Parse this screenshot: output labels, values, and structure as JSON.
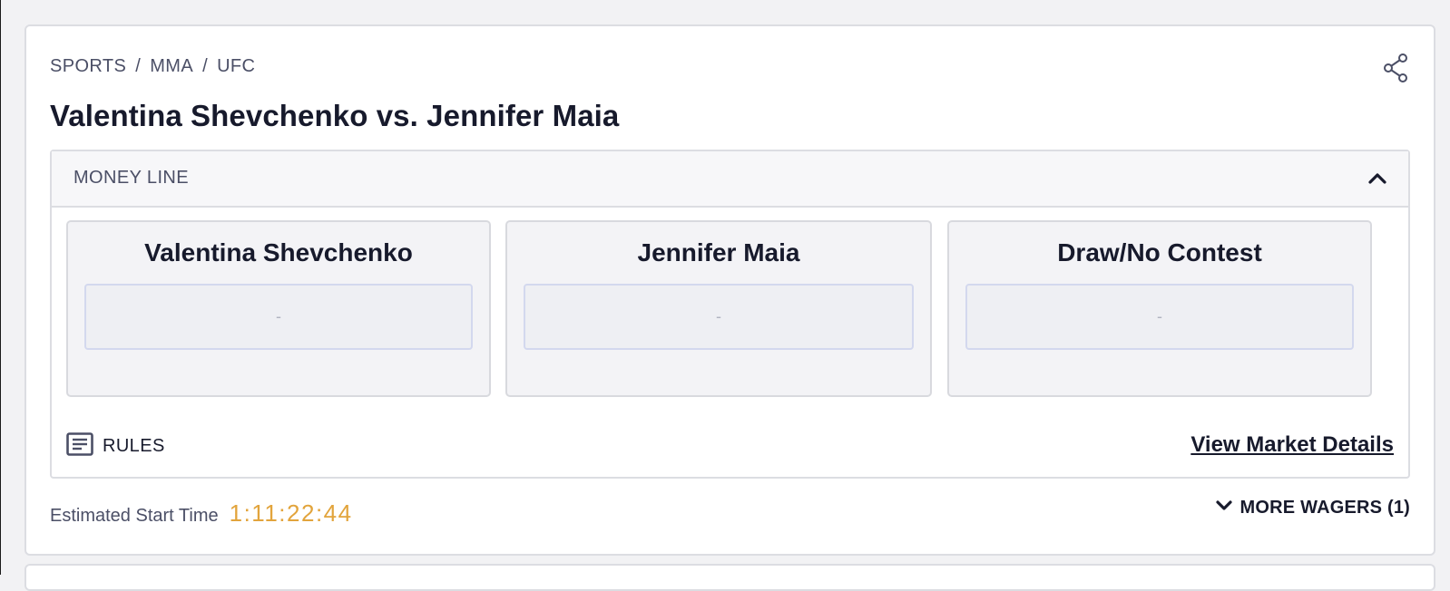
{
  "breadcrumb": {
    "items": [
      "SPORTS",
      "MMA",
      "UFC"
    ],
    "separator": "/"
  },
  "event": {
    "title": "Valentina Shevchenko vs. Jennifer Maia"
  },
  "market": {
    "label": "MONEY LINE",
    "outcomes": [
      {
        "name": "Valentina Shevchenko",
        "odds": "-"
      },
      {
        "name": "Jennifer Maia",
        "odds": "-"
      },
      {
        "name": "Draw/No Contest",
        "odds": "-"
      }
    ],
    "rules_label": "RULES",
    "view_details_label": "View Market Details"
  },
  "footer": {
    "start_label": "Estimated Start Time",
    "countdown": "1:11:22:44",
    "more_wagers_label": "MORE WAGERS (1)"
  },
  "icons": {
    "share": "share-icon",
    "collapse": "chevron-up-icon",
    "rules": "document-lines-icon",
    "expand": "chevron-down-icon"
  },
  "colors": {
    "accent_countdown": "#e2a43c",
    "title_text": "#171a2c",
    "muted_text": "#4b4f66",
    "card_border": "#dcdde2",
    "odds_border": "#d3d8ee"
  }
}
